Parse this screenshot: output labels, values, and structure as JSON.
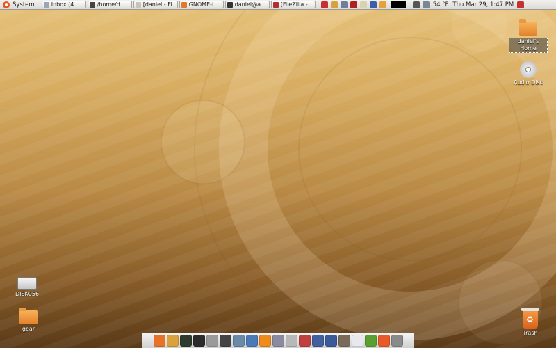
{
  "top_panel": {
    "menu_label": "System",
    "tasks": [
      {
        "label": "Inbox (4...",
        "icon": "mail-icon",
        "color": "#9aa5b5"
      },
      {
        "label": "/home/d...",
        "icon": "folder-icon",
        "color": "#444444"
      },
      {
        "label": "[daniel - Fi...",
        "icon": "file-manager-icon",
        "color": "#c9c4b9"
      },
      {
        "label": "GNOME-L...",
        "icon": "browser-icon",
        "color": "#e07a2a"
      },
      {
        "label": "daniel@a...",
        "icon": "terminal-icon",
        "color": "#333333"
      },
      {
        "label": "[FileZilla - ...",
        "icon": "filezilla-icon",
        "color": "#b03030"
      }
    ],
    "tray_icons": [
      {
        "name": "filezilla-tray-icon",
        "color": "#c83030"
      },
      {
        "name": "gimp-tray-icon",
        "color": "#d6a23a"
      },
      {
        "name": "magnifier-tray-icon",
        "color": "#6f7f99"
      },
      {
        "name": "ruby-tray-icon",
        "color": "#b02020"
      },
      {
        "name": "notes-tray-icon",
        "color": "#d8d2b0"
      },
      {
        "name": "signal-tray-icon",
        "color": "#3b5fa8"
      },
      {
        "name": "weather-cloud-tray-icon",
        "color": "#e4a23a"
      }
    ],
    "extra_tray_icons": [
      {
        "name": "battery-tray-icon",
        "color": "#555555"
      },
      {
        "name": "network-tray-icon",
        "color": "#7a8896"
      }
    ],
    "weather": "54 °F",
    "clock": "Thu Mar 29,  1:47 PM",
    "power_icon": {
      "name": "power-icon",
      "color": "#c83030"
    }
  },
  "desktop": {
    "home": {
      "label": "daniel's Home"
    },
    "audio_disc": {
      "label": "Audio Disc"
    },
    "disk": {
      "label": "DISK056"
    },
    "gear": {
      "label": "gear"
    },
    "trash": {
      "label": "Trash"
    }
  },
  "dock": {
    "icons": [
      {
        "name": "firefox-icon",
        "color": "#e8722a"
      },
      {
        "name": "gimp-icon",
        "color": "#d9a23c"
      },
      {
        "name": "terminal-icon",
        "color": "#2f3a2f"
      },
      {
        "name": "tux-icon",
        "color": "#2b2b2b"
      },
      {
        "name": "script-icon",
        "color": "#9a9a9a"
      },
      {
        "name": "inkscape-icon",
        "color": "#444444"
      },
      {
        "name": "network-icon",
        "color": "#6a8aa8"
      },
      {
        "name": "globe-icon",
        "color": "#4a7ab8"
      },
      {
        "name": "vlc-icon",
        "color": "#f08a1a"
      },
      {
        "name": "media-icon",
        "color": "#8a8aa0"
      },
      {
        "name": "clock-icon",
        "color": "#b8b8b8"
      },
      {
        "name": "audio-icon",
        "color": "#c04040"
      },
      {
        "name": "pen-icon",
        "color": "#4060a0"
      },
      {
        "name": "monitor-icon",
        "color": "#3a5a9a"
      },
      {
        "name": "gimp-wilber-icon",
        "color": "#7a6a5a"
      },
      {
        "name": "document-icon",
        "color": "#e8e8ee"
      },
      {
        "name": "puzzle-icon",
        "color": "#5aa030"
      },
      {
        "name": "help-icon",
        "color": "#e85a2a"
      },
      {
        "name": "settings-icon",
        "color": "#8a8a8a"
      }
    ]
  }
}
